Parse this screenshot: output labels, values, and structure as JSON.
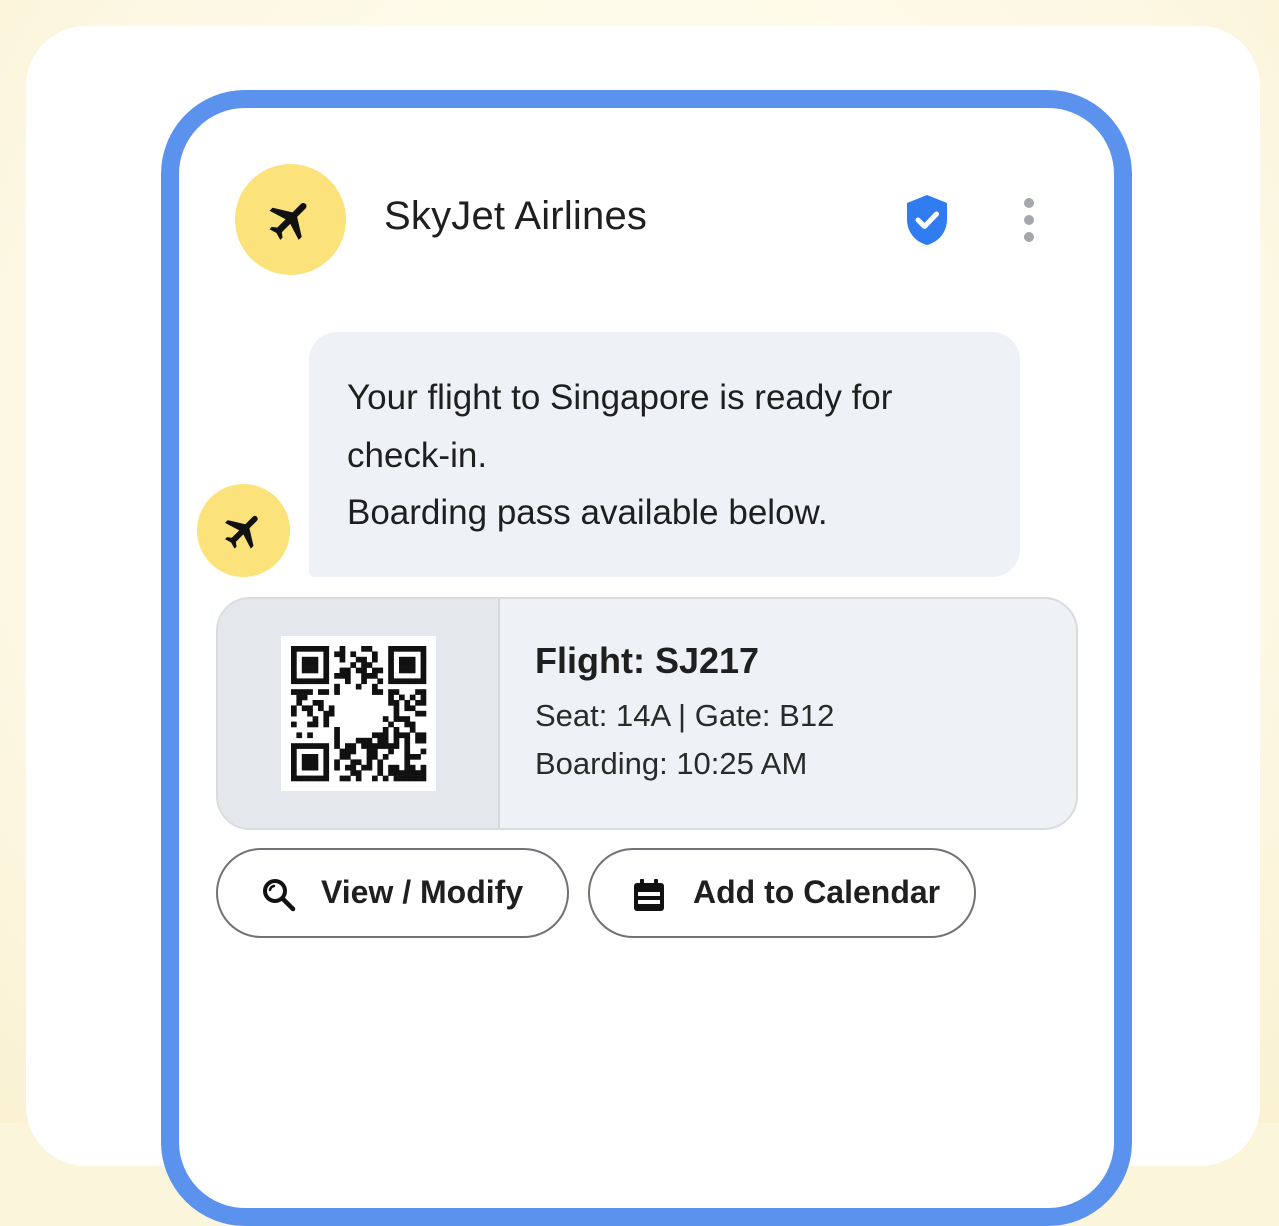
{
  "header": {
    "sender_name": "SkyJet Airlines",
    "avatar_icon": "airplane-icon",
    "verified_icon": "verified-shield-icon",
    "menu_icon": "more-vertical-icon"
  },
  "message": {
    "lines": [
      "Your flight to Singapore is ready for",
      "check-in.",
      "Boarding pass available below."
    ],
    "avatar_icon": "airplane-icon"
  },
  "boarding_pass": {
    "qr_icon": "qr-code-icon",
    "flight": "Flight: SJ217",
    "seat_gate": "Seat: 14A | Gate: B12",
    "boarding": "Boarding: 10:25 AM"
  },
  "actions": [
    {
      "label": "View / Modify",
      "icon": "search-icon"
    },
    {
      "label": "Add to Calendar",
      "icon": "calendar-icon"
    }
  ],
  "colors": {
    "frame": "#5b92ee",
    "avatar": "#fbe27a",
    "verified": "#2f7cf0",
    "bubble": "#eef1f5"
  }
}
